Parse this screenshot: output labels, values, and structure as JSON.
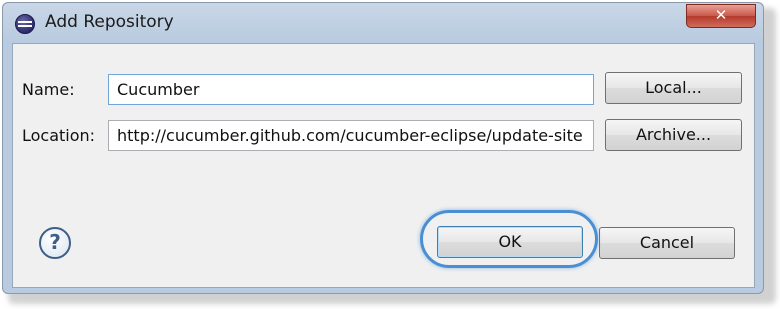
{
  "window": {
    "title": "Add Repository",
    "close_glyph": "✕"
  },
  "form": {
    "name_label": "Name:",
    "name_value": "Cucumber",
    "location_label": "Location:",
    "location_value": "http://cucumber.github.com/cucumber-eclipse/update-site"
  },
  "buttons": {
    "local": "Local...",
    "archive": "Archive...",
    "ok": "OK",
    "cancel": "Cancel",
    "help_glyph": "?"
  },
  "colors": {
    "highlight": "#4a8fd4",
    "close": "#c9584a"
  },
  "icons": {
    "app": "eclipse-icon",
    "help": "help-icon",
    "close": "close-icon"
  }
}
